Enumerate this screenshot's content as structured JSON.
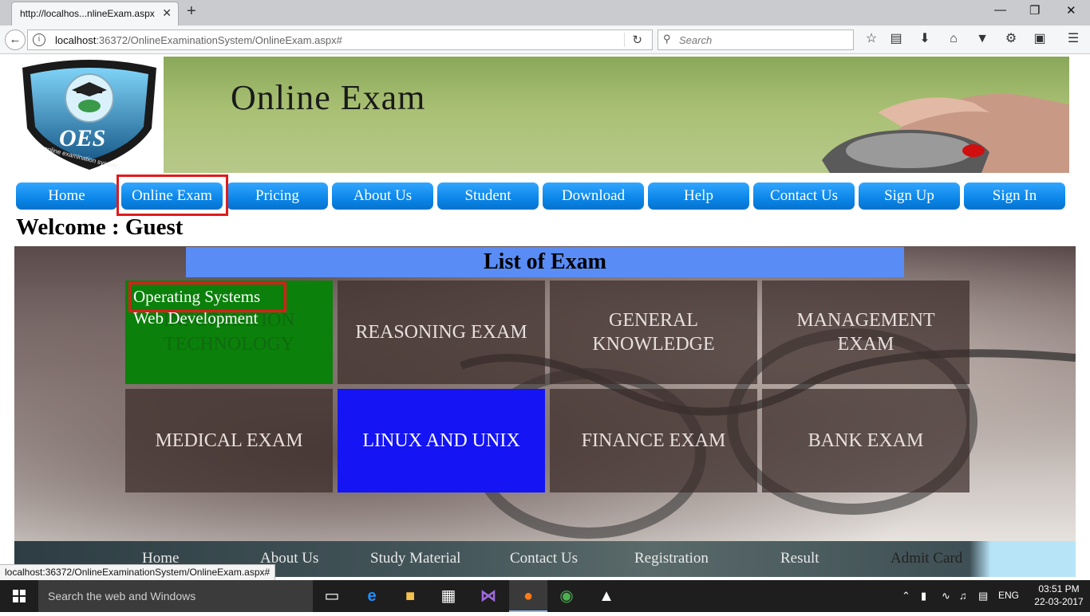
{
  "browser": {
    "tab_title": "http://localhos...nlineExam.aspx",
    "tab_close": "✕",
    "new_tab": "+",
    "url_host": "localhost",
    "url_rest": ":36372/OnlineExaminationSystem/OnlineExam.aspx#",
    "search_placeholder": "Search"
  },
  "site": {
    "banner_title": "Online Exam",
    "logo_text": "OES",
    "logo_subtext": "online examination system",
    "menu": [
      "Home",
      "Online Exam",
      "Pricing",
      "About Us",
      "Student",
      "Download",
      "Help",
      "Contact Us",
      "Sign Up",
      "Sign In"
    ],
    "welcome": "Welcome : Guest",
    "list_header": "List of Exam",
    "exams": [
      "INFORMATION TECHNOLOGY",
      "REASONING EXAM",
      "GENERAL KNOWLEDGE",
      "MANAGEMENT EXAM",
      "MEDICAL EXAM",
      "LINUX AND UNIX",
      "FINANCE EXAM",
      "BANK EXAM"
    ],
    "dropdown_items": [
      "Operating Systems",
      "Web Development"
    ],
    "footer_links": [
      "Home",
      "About Us",
      "Study Material",
      "Contact Us",
      "Registration",
      "Result",
      "Admit Card"
    ]
  },
  "status_bar": "localhost:36372/OnlineExaminationSystem/OnlineExam.aspx#",
  "taskbar": {
    "search_text": "Search the web and Windows",
    "language": "ENG",
    "time": "03:51 PM",
    "date": "22-03-2017"
  },
  "colors": {
    "menu_blue": "#0b86e8",
    "highlight_red": "#e01b1b",
    "card_green": "#0b800b",
    "card_blue": "#1414f5",
    "header_blue": "#5a8cf5"
  }
}
